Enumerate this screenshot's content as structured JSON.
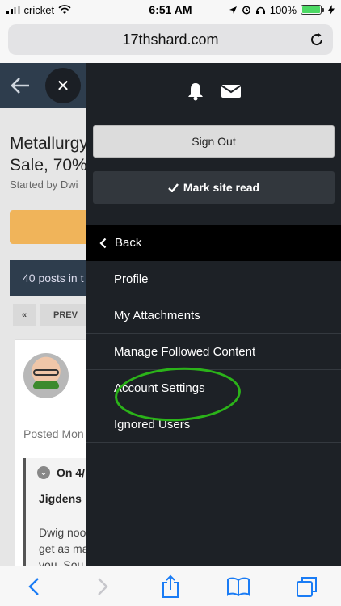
{
  "status_bar": {
    "carrier": "cricket",
    "time": "6:51 AM",
    "battery": "100%",
    "battery_level": 1.0
  },
  "browser": {
    "url": "17thshard.com"
  },
  "page": {
    "thread_title_line1": "Metallurgy",
    "thread_title_line2": "Sale, 70%",
    "thread_started": "Started by Dwi",
    "posts_count": "40 posts in t",
    "pager_prev": "PREV",
    "posted": "Posted Mon",
    "quote_head": "On 4/",
    "quote_author": "Jigdens",
    "quote_text_lines": [
      "Dwig noo",
      "get as ma",
      "you. Sou"
    ]
  },
  "drawer": {
    "sign_out": "Sign Out",
    "mark_read": "Mark site read",
    "menu_back": "Back",
    "menu_items": [
      "Profile",
      "My Attachments",
      "Manage Followed Content",
      "Account Settings",
      "Ignored Users"
    ]
  },
  "colors": {
    "drawer_bg": "#1d2126",
    "header_bg": "#2e3d4d",
    "accent_orange": "#f0b45a",
    "highlight_green": "#2bb319",
    "ios_blue": "#1a7cf5"
  }
}
